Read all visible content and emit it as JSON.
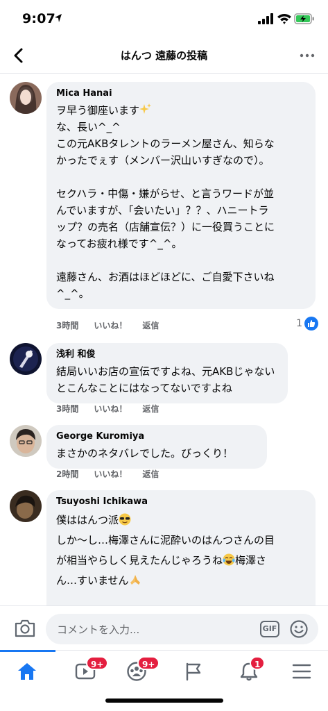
{
  "status": {
    "time": "9:07"
  },
  "header": {
    "title": "はんつ 遠藤の投稿"
  },
  "comments": [
    {
      "author": "Mica Hanai",
      "lines": [
        "ヲ早う御座います",
        "な、長い^_^",
        "この元AKBタレントのラーメン屋さん、知らな",
        "かったでぇす（メンバー沢山いすぎなので）。",
        "",
        "セクハラ・中傷・嫌がらせ、と言うワードが並",
        "んでいますが、「会いたい」？？、ハニートラ",
        "ップ？の売名（店舗宣伝？）に一役買うことに",
        "なってお疲れ様です^_^。",
        "",
        "遠藤さん、お酒はほどほどに、ご自愛下さいね",
        "^_^。"
      ],
      "time": "3時間",
      "like": "いいね！",
      "reply": "返信",
      "reactions": "1"
    },
    {
      "author": "浅利 和俊",
      "lines": [
        "結局いいお店の宣伝ですよね、元AKBじゃない",
        "とこんなことにはなってないですよね"
      ],
      "time": "3時間",
      "like": "いいね！",
      "reply": "返信"
    },
    {
      "author": "George Kuromiya",
      "lines": [
        "まさかのネタバレでした。びっくり！"
      ],
      "time": "2時間",
      "like": "いいね！",
      "reply": "返信"
    },
    {
      "author": "Tsuyoshi Ichikawa",
      "lines": [
        "僕ははんつ派",
        "しか〜し…梅澤さんに泥酔いのはんつさんの目",
        "が相当やらしく見えたんじゃろうね",
        "梅澤さ",
        "ん…すいません"
      ]
    }
  ],
  "composer": {
    "placeholder": "コメントを入力...",
    "gif_label": "GIF"
  },
  "tabbar": {
    "badges": {
      "watch": "9+",
      "groups": "9+",
      "notifications": "1"
    }
  },
  "colors": {
    "accent": "#1877f2",
    "badge": "#e41e3f",
    "bubble": "#f0f2f5"
  }
}
